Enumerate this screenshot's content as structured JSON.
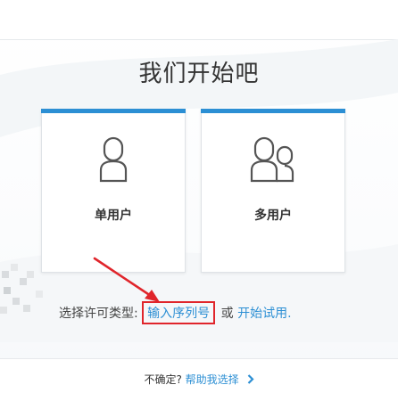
{
  "title": "我们开始吧",
  "cards": [
    {
      "label": "单用户",
      "icon": "single-user-icon"
    },
    {
      "label": "多用户",
      "icon": "multi-user-icon"
    }
  ],
  "license": {
    "prompt": "选择许可类型:",
    "serial_link": "输入序列号",
    "or": "或",
    "trial_link": "开始试用."
  },
  "help": {
    "prompt": "不确定?",
    "link": "帮助我选择",
    "icon": "chevron-right-icon"
  },
  "colors": {
    "accent": "#2c8fd4",
    "annotation": "#e0252b"
  }
}
